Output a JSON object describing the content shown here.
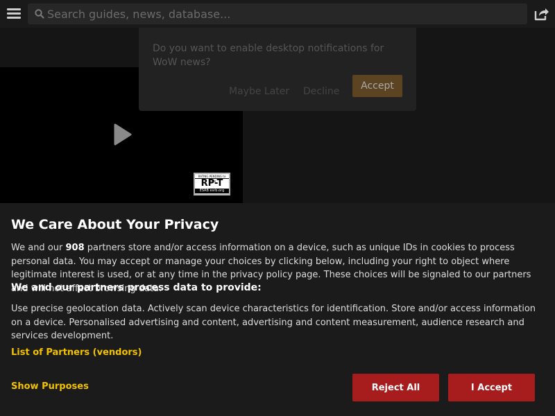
{
  "search": {
    "placeholder": "Search guides, news, database..."
  },
  "notification": {
    "message": "Do you want to enable desktop notifications for WoW news?",
    "maybe_later": "Maybe Later",
    "decline": "Decline",
    "accept": "Accept"
  },
  "video": {
    "rating_top": "RATING PENDING to TEEN",
    "rating_code": "RP-T",
    "rating_bottom": "ESRB esrb.org"
  },
  "privacy": {
    "title": "We Care About Your Privacy",
    "intro_before": "We and our ",
    "partner_count": "908",
    "intro_after": " partners store and/or access information on a device, such as unique IDs in cookies to process personal data. You may accept or manage your choices by clicking below, including your right to object where legitimate interest is used, or at any time in the privacy policy page. These choices will be signaled to our partners and will not affect browsing data.",
    "subheading": "We and our partners process data to provide:",
    "purposes": "Use precise geolocation data. Actively scan device characteristics for identification. Store and/or access information on a device. Personalised advertising and content, advertising and content measurement, audience research and services development.",
    "vendors_link": "List of Partners (vendors)",
    "show_purposes": "Show Purposes",
    "reject_all": "Reject All",
    "accept": "I Accept"
  },
  "colors": {
    "accent_link": "#f2c200",
    "button_red": "#a71d1d",
    "accept_brown": "#5c4322"
  }
}
